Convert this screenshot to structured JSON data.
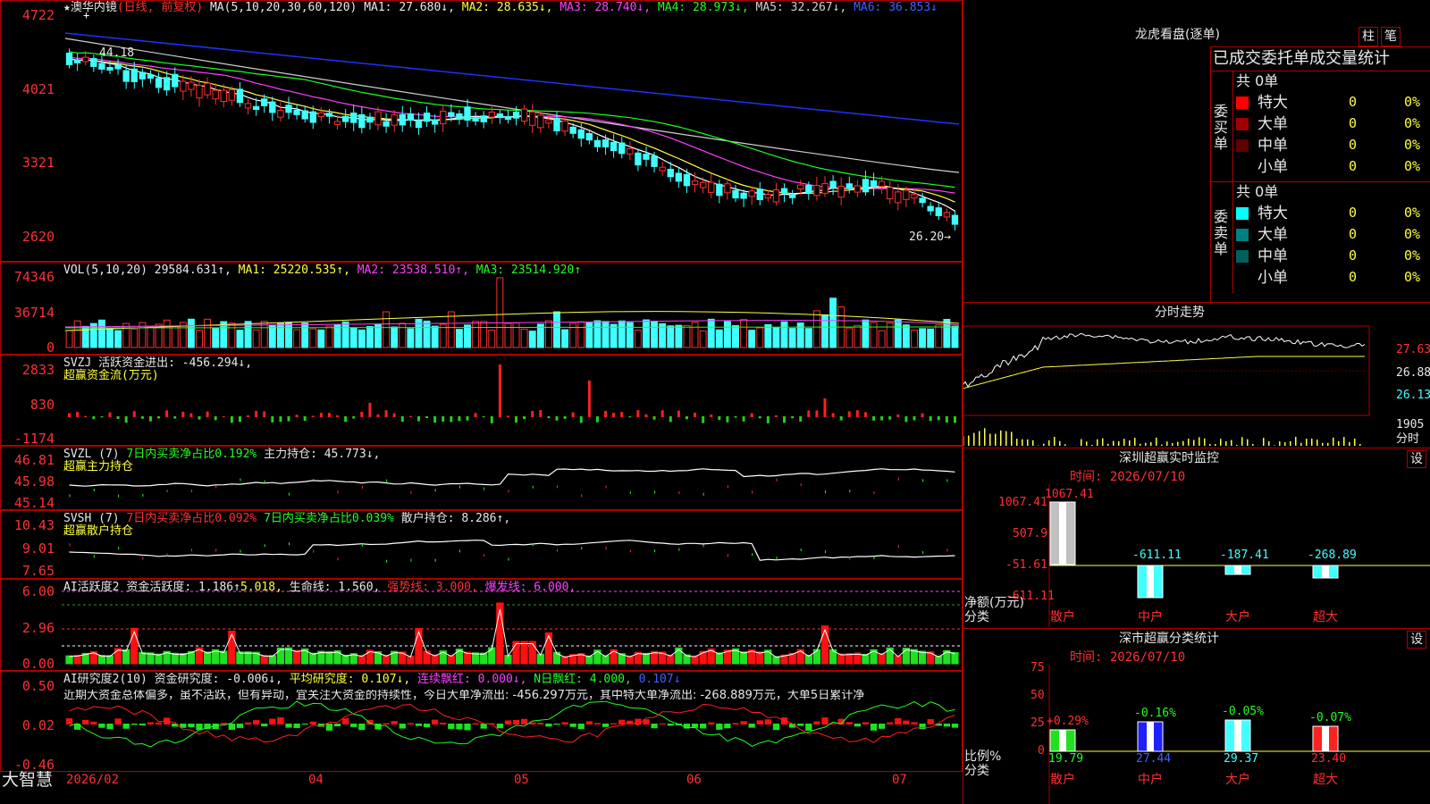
{
  "corner_logo": "大智慧",
  "title": {
    "prefix": "★",
    "stock": "澳华内镜",
    "period": "(日线, 前复权)"
  },
  "ma_main": {
    "params": "MA(5,10,20,30,60,120)",
    "ma1": "MA1: 27.680↓,",
    "ma2": "MA2: 28.635↓,",
    "ma3": "MA3: 28.740↓,",
    "ma4": "MA4: 28.973↓,",
    "ma5": "MA5: 32.267↓,",
    "ma6": "MA6: 36.853↓"
  },
  "price_axis": [
    "4722",
    "4021",
    "3321",
    "2620"
  ],
  "price_high": "44.18",
  "price_low": "26.20→",
  "vol": {
    "label": "VOL(5,10,20)",
    "value": "29584.631↑,",
    "ma1": "MA1: 25220.535↑,",
    "ma2": "MA2: 23538.510↑,",
    "ma3": "MA3: 23514.920↑",
    "axis": [
      "74346",
      "36714",
      "0"
    ]
  },
  "svzj": {
    "label": "SVZJ  活跃资金进出: -456.294↓,",
    "sub": "超赢资金流(万元)",
    "axis": [
      "2833",
      "830",
      "-1174"
    ]
  },
  "svzl": {
    "label": "SVZL (7)",
    "ratio": "7日内买卖净占比0.192%",
    "hold": "主力持仓: 45.773↓,",
    "sub": "超赢主力持仓",
    "axis": [
      "46.81",
      "45.98",
      "45.14"
    ]
  },
  "svsh": {
    "label": "SVSH (7)",
    "ratio1": "7日内买卖净占比0.092%",
    "ratio2": "7日内买卖净占比0.039%",
    "hold": "散户持仓: 8.286↑,",
    "sub": "超赢散户持仓",
    "axis": [
      "10.43",
      "9.01",
      "7.65"
    ]
  },
  "ai_active": {
    "label": "AI活跃度2",
    "a": "资金活跃度: 1.186↑",
    "b": "5.018,",
    "c": "生命线: 1.560,",
    "d": "强势线: 3.000,",
    "e": "爆发线: 6.000,",
    "axis": [
      "6.00",
      "2.96",
      "0.00"
    ]
  },
  "ai_research": {
    "label": "AI研究度2(10)",
    "a": "资金研究度: -0.006↓,",
    "b": "平均研究度: 0.107↓,",
    "c": "连续飘红: 0.000↓,",
    "d": "N日飘红: 4.000,",
    "e": "0.107↓",
    "comment": "近期大资金总体偏多，虽不活跃，但有异动，宜关注大资金的持续性，今日大单净流出: -456.297万元，其中特大单净流出: -268.889万元，大单5日累计净",
    "axis": [
      "0.50",
      "0.02",
      "-0.46"
    ]
  },
  "dates": [
    "2026/02",
    "04",
    "05",
    "06",
    "07"
  ],
  "longhu": {
    "title": "龙虎看盘(逐单)",
    "btn1": "柱",
    "btn2": "笔",
    "subtitle": "已成交委托单成交量统计",
    "buy": {
      "side": "委买单",
      "total": "共 0单",
      "rows": [
        {
          "name": "特大",
          "v": "0",
          "p": "0%",
          "color": "#ff0000"
        },
        {
          "name": "大单",
          "v": "0",
          "p": "0%",
          "color": "#a00000"
        },
        {
          "name": "中单",
          "v": "0",
          "p": "0%",
          "color": "#600000"
        },
        {
          "name": "小单",
          "v": "0",
          "p": "0%",
          "color": "#000000"
        }
      ]
    },
    "sell": {
      "side": "委卖单",
      "total": "共 0单",
      "rows": [
        {
          "name": "特大",
          "v": "0",
          "p": "0%",
          "color": "#00ffff"
        },
        {
          "name": "大单",
          "v": "0",
          "p": "0%",
          "color": "#008080"
        },
        {
          "name": "中单",
          "v": "0",
          "p": "0%",
          "color": "#006060"
        },
        {
          "name": "小单",
          "v": "0",
          "p": "0%",
          "color": "#000000"
        }
      ]
    }
  },
  "intraday": {
    "title": "分时走势",
    "axis": [
      "27.63",
      "26.88",
      "26.13"
    ],
    "vol": "1905",
    "vol_unit": "分时"
  },
  "monitor": {
    "title": "深圳超赢实时监控",
    "settings": "设",
    "time": "时间: 2026/07/10",
    "axis": [
      "1067.41",
      "507.9",
      "-51.61",
      "-611.11"
    ],
    "unit": "净额(万元)",
    "cat_label": "分类",
    "bars": [
      {
        "cat": "散户",
        "val": "1067.41"
      },
      {
        "cat": "中户",
        "val": "-611.11"
      },
      {
        "cat": "大户",
        "val": "-187.41"
      },
      {
        "cat": "超大",
        "val": "-268.89"
      }
    ]
  },
  "classify": {
    "title": "深市超赢分类统计",
    "settings": "设",
    "time": "时间: 2026/07/10",
    "axis": [
      "75",
      "50",
      "25",
      "0"
    ],
    "unit": "比例%",
    "cat_label": "分类",
    "bars": [
      {
        "cat": "散户",
        "pct": "+0.29%",
        "val": "19.79"
      },
      {
        "cat": "中户",
        "pct": "-0.16%",
        "val": "27.44"
      },
      {
        "cat": "大户",
        "pct": "-0.05%",
        "val": "29.37"
      },
      {
        "cat": "超大",
        "pct": "-0.07%",
        "val": "23.40"
      }
    ]
  },
  "colors": {
    "up": "#ff3030",
    "down": "#40ffff",
    "grid": "#b00000"
  }
}
